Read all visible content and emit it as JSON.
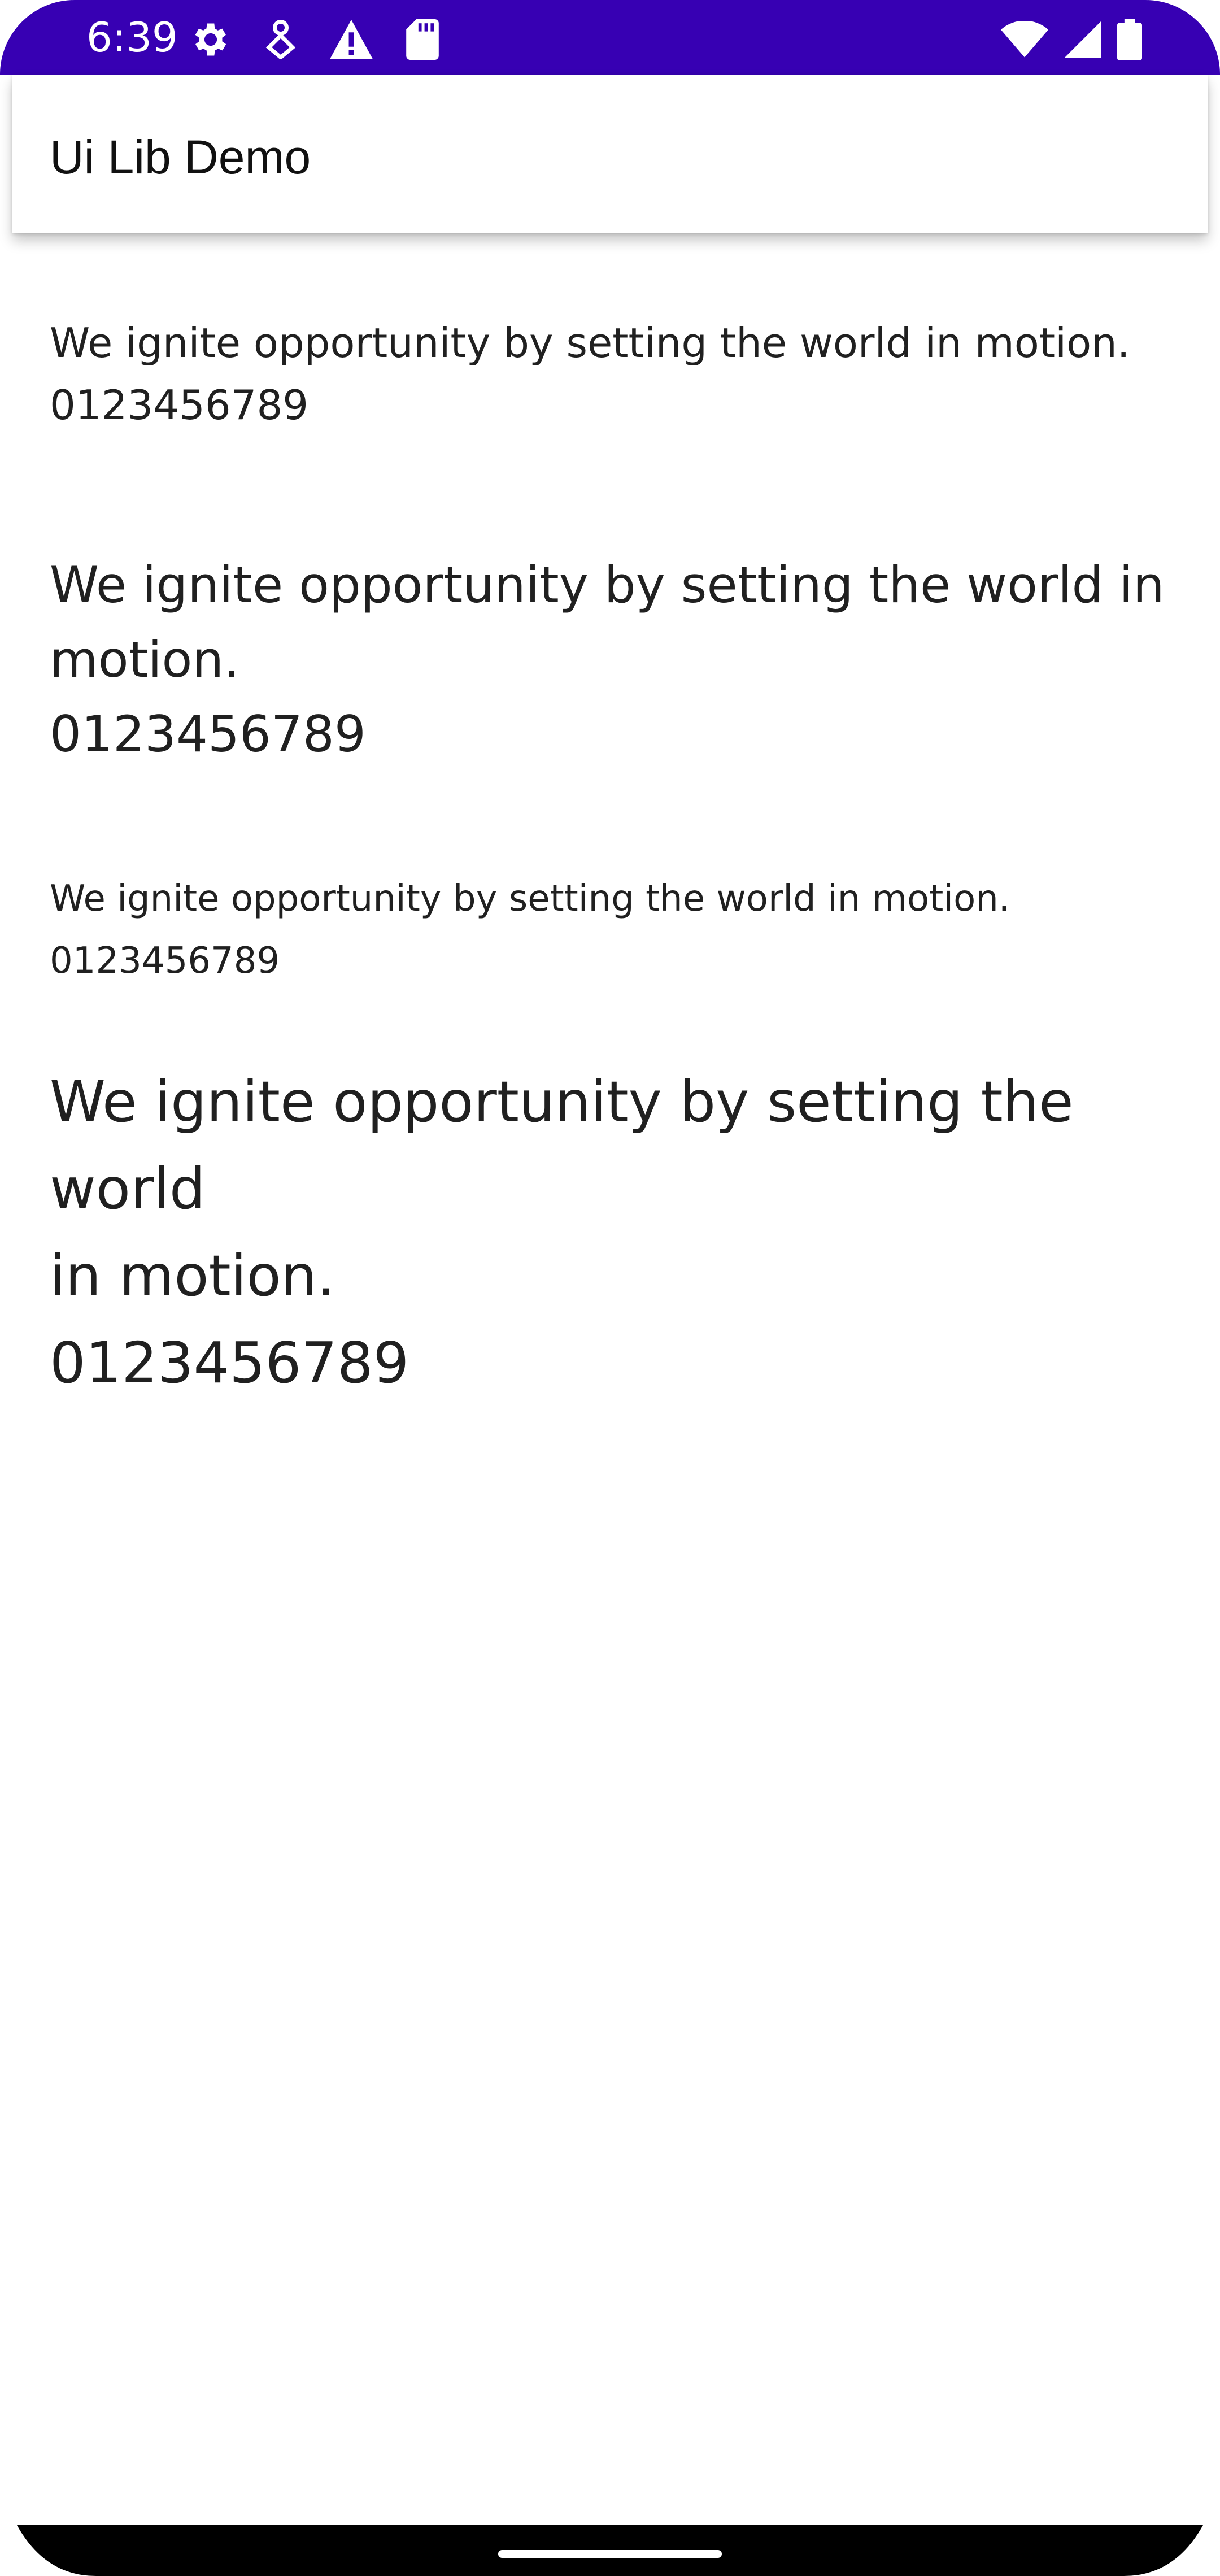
{
  "status_bar": {
    "time": "6:39",
    "left_icons": [
      "gear-icon",
      "download-icon",
      "warning-icon",
      "sd-card-icon"
    ],
    "right_icons": [
      "wifi-icon",
      "cell-signal-icon",
      "battery-icon"
    ],
    "background": "#3700b3"
  },
  "app_bar": {
    "title": "Ui Lib Demo"
  },
  "samples": [
    {
      "text": "We ignite opportunity by setting the world in motion.",
      "digits": "0123456789"
    },
    {
      "text_line1": "We ignite opportunity by setting the world in",
      "text_line2": "motion.",
      "digits": "0123456789"
    },
    {
      "text": "We ignite opportunity by setting the world in motion.",
      "digits": "0123456789"
    },
    {
      "text_line1": "We ignite opportunity by setting the world",
      "text_line2": "in motion.",
      "digits": "0123456789"
    }
  ]
}
